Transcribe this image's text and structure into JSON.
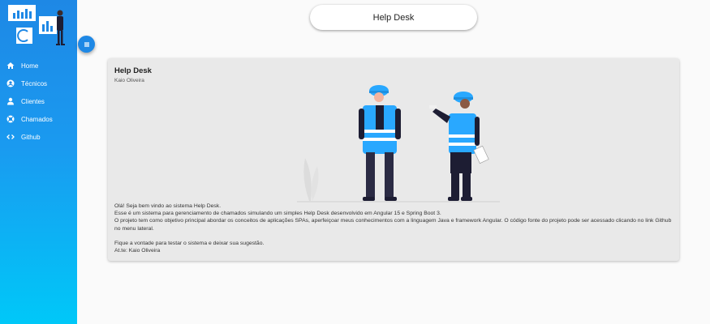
{
  "header": {
    "title": "Help Desk"
  },
  "sidebar": {
    "items": [
      {
        "label": "Home",
        "icon": "home-icon"
      },
      {
        "label": "Técnicos",
        "icon": "account-circle-icon"
      },
      {
        "label": "Clientes",
        "icon": "person-icon"
      },
      {
        "label": "Chamados",
        "icon": "support-icon"
      },
      {
        "label": "Github",
        "icon": "code-icon"
      }
    ]
  },
  "card": {
    "title": "Help Desk",
    "subtitle": "Kaio Oliveira",
    "lines": [
      "Olá! Seja bem vindo ao sistema Help Desk.",
      "Esse é um sistema para gerenciamento de chamados simulando um simples Help Desk desenvolvido em Angular 15 e Spring Boot 3.",
      "O projeto tem como objetivo principal abordar os conceitos de aplicações SPAs, aperfeiçoar meus conhecimentos com a linguagem Java e framework Angular. O código fonte do projeto pode ser acessado clicando no link Github no menu lateral.",
      "Fique a vontade para testar o sistema e deixar sua sugestão.",
      "At.te: Kaio Oliveira"
    ]
  },
  "colors": {
    "sidebar_top": "#1e88e5",
    "sidebar_bottom": "#00c8f8",
    "accent": "#1e88e5",
    "helmet": "#29a8ff"
  }
}
